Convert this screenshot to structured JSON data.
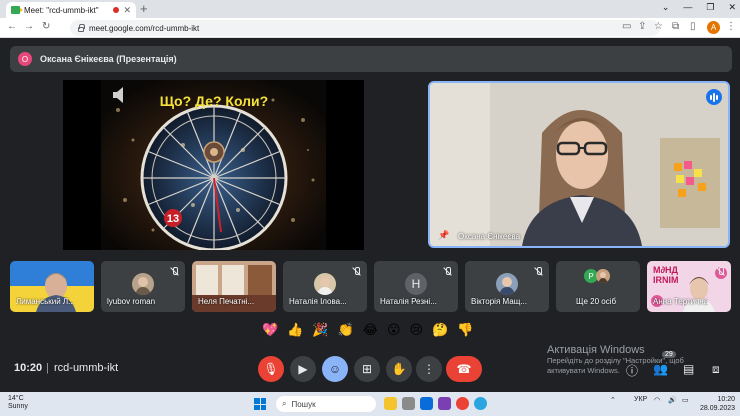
{
  "browser": {
    "tab_title": "Meet: \"rcd-ummb-ikt\"",
    "url": "meet.google.com/rcd-ummb-ikt",
    "profile_initial": "A"
  },
  "presentation": {
    "presenter_initial": "О",
    "presenter_label": "Оксана Єнікеєва (Презентація)",
    "slide_title": "Що? Де? Коли?",
    "slide_number": "13"
  },
  "camera": {
    "name": "Оксана Єнікеєва"
  },
  "participants": [
    {
      "name": "Лиманський Л...",
      "muted": false
    },
    {
      "name": "lyubov roman",
      "muted": true
    },
    {
      "name": "Неля Печатні...",
      "muted": false
    },
    {
      "name": "Наталія Ілова...",
      "muted": true
    },
    {
      "name": "Наталія Резні...",
      "initial": "Н",
      "muted": true
    },
    {
      "name": "Вікторія Мащ...",
      "muted": true
    },
    {
      "name": "Ще 20 осіб",
      "initial": "Р"
    },
    {
      "name": "Анна Тертична",
      "muted": true
    }
  ],
  "reactions": [
    "💖",
    "👍",
    "🎉",
    "👏",
    "😂",
    "😮",
    "😢",
    "🤔",
    "👎"
  ],
  "meeting": {
    "time": "10:20",
    "code": "rcd-ummb-ikt",
    "people_count": "29"
  },
  "activation": {
    "title": "Активація Windows",
    "text": "Перейдіть до розділу \"Настройки\", щоб активувати Windows."
  },
  "taskbar": {
    "temperature": "14°C",
    "weather": "Sunny",
    "search_label": "Пошук",
    "language": "УКР",
    "time": "10:20",
    "date": "28.09.2023"
  },
  "colors": {
    "meet_bg": "#202124",
    "surface": "#3c4043",
    "accent_blue": "#8ab4f8",
    "end_call_red": "#ea4335"
  }
}
